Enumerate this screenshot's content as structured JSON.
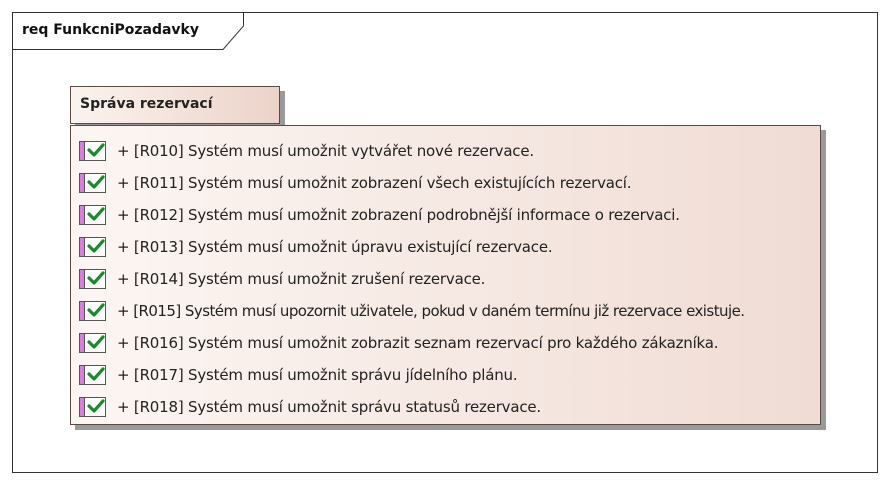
{
  "frame": {
    "title": "req FunkcniPozadavky"
  },
  "package": {
    "title": "Správa rezervací",
    "requirements": [
      {
        "text": "+ [R010] Systém musí umožnit vytvářet nové rezervace."
      },
      {
        "text": "+ [R011] Systém musí umožnit zobrazení všech existujících rezervací."
      },
      {
        "text": "+ [R012] Systém musí umožnit zobrazení podrobnější informace o rezervaci."
      },
      {
        "text": "+ [R013] Systém musí umožnit úpravu existující rezervace."
      },
      {
        "text": "+ [R014] Systém musí umožnit zrušení rezervace."
      },
      {
        "text": "+ [R015] Systém musí upozornit uživatele, pokud v daném termínu již rezervace existuje."
      },
      {
        "text": "+ [R016] Systém musí umožnit zobrazit seznam rezervací pro každého zákazníka."
      },
      {
        "text": "+ [R017] Systém musí umožnit správu jídelního plánu."
      },
      {
        "text": "+ [R018] Systém musí umožnit správu statusů rezervace."
      }
    ]
  },
  "colors": {
    "icon_bar": "#d97fd9",
    "check": "#1a8a2e"
  },
  "icons": {
    "requirement": "requirement-check-icon"
  }
}
